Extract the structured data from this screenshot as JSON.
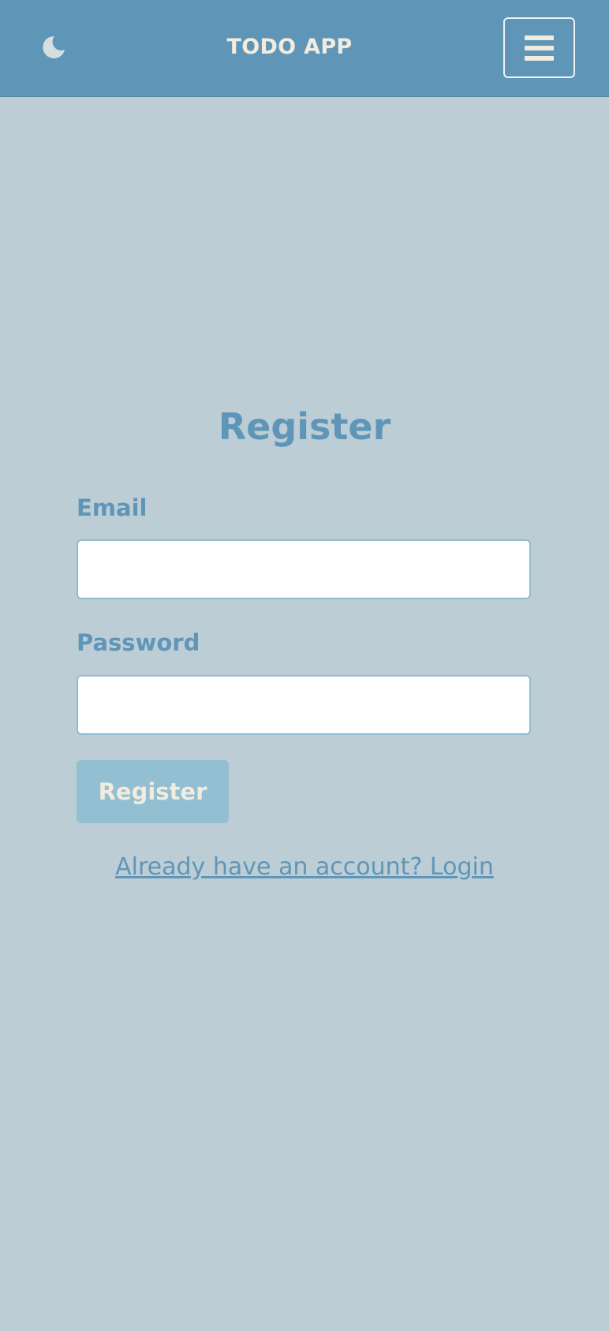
{
  "navbar": {
    "theme_icon": "moon-icon",
    "brand": "TODO APP",
    "menu_icon": "hamburger-icon",
    "bg_color": "#5f96b7"
  },
  "form": {
    "title": "Register",
    "email_label": "Email",
    "email_value": "",
    "password_label": "Password",
    "password_value": "",
    "submit_label": "Register",
    "login_link": "Already have an account? Login"
  },
  "colors": {
    "page_bg": "#bccdd6",
    "accent": "#5f96b7",
    "button_bg": "#93bfd2",
    "button_text": "#f2ece0"
  }
}
